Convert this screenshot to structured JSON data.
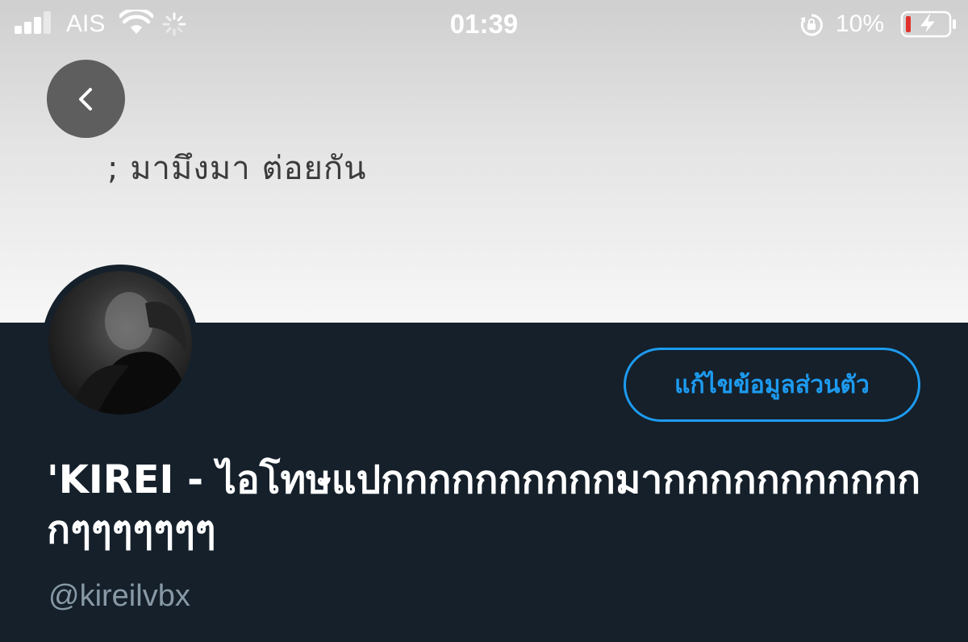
{
  "status_bar": {
    "carrier": "AIS",
    "time": "01:39",
    "battery_percent": "10%",
    "battery_level": 0.1,
    "signal_bars": 3,
    "icons": [
      "signal-icon",
      "wifi-icon",
      "activity-spinner-icon",
      "rotation-lock-icon",
      "battery-charging-icon"
    ]
  },
  "header": {
    "back_icon": "chevron-left-icon",
    "banner_text": "; มามึงมา ต่อยกัน"
  },
  "profile": {
    "edit_button_label": "แก้ไขข้อมูลส่วนตัว",
    "display_name": "'KIREI - ไอโทษแปกกกกกกกกกกมากกกกกกกกกกกกๆๆๆๆๆๆๆ",
    "handle": "@kireilvbx"
  },
  "colors": {
    "background": "#15202b",
    "accent": "#1d9bf0",
    "handle": "#8899a6",
    "back_button": "#5e5e5e"
  }
}
